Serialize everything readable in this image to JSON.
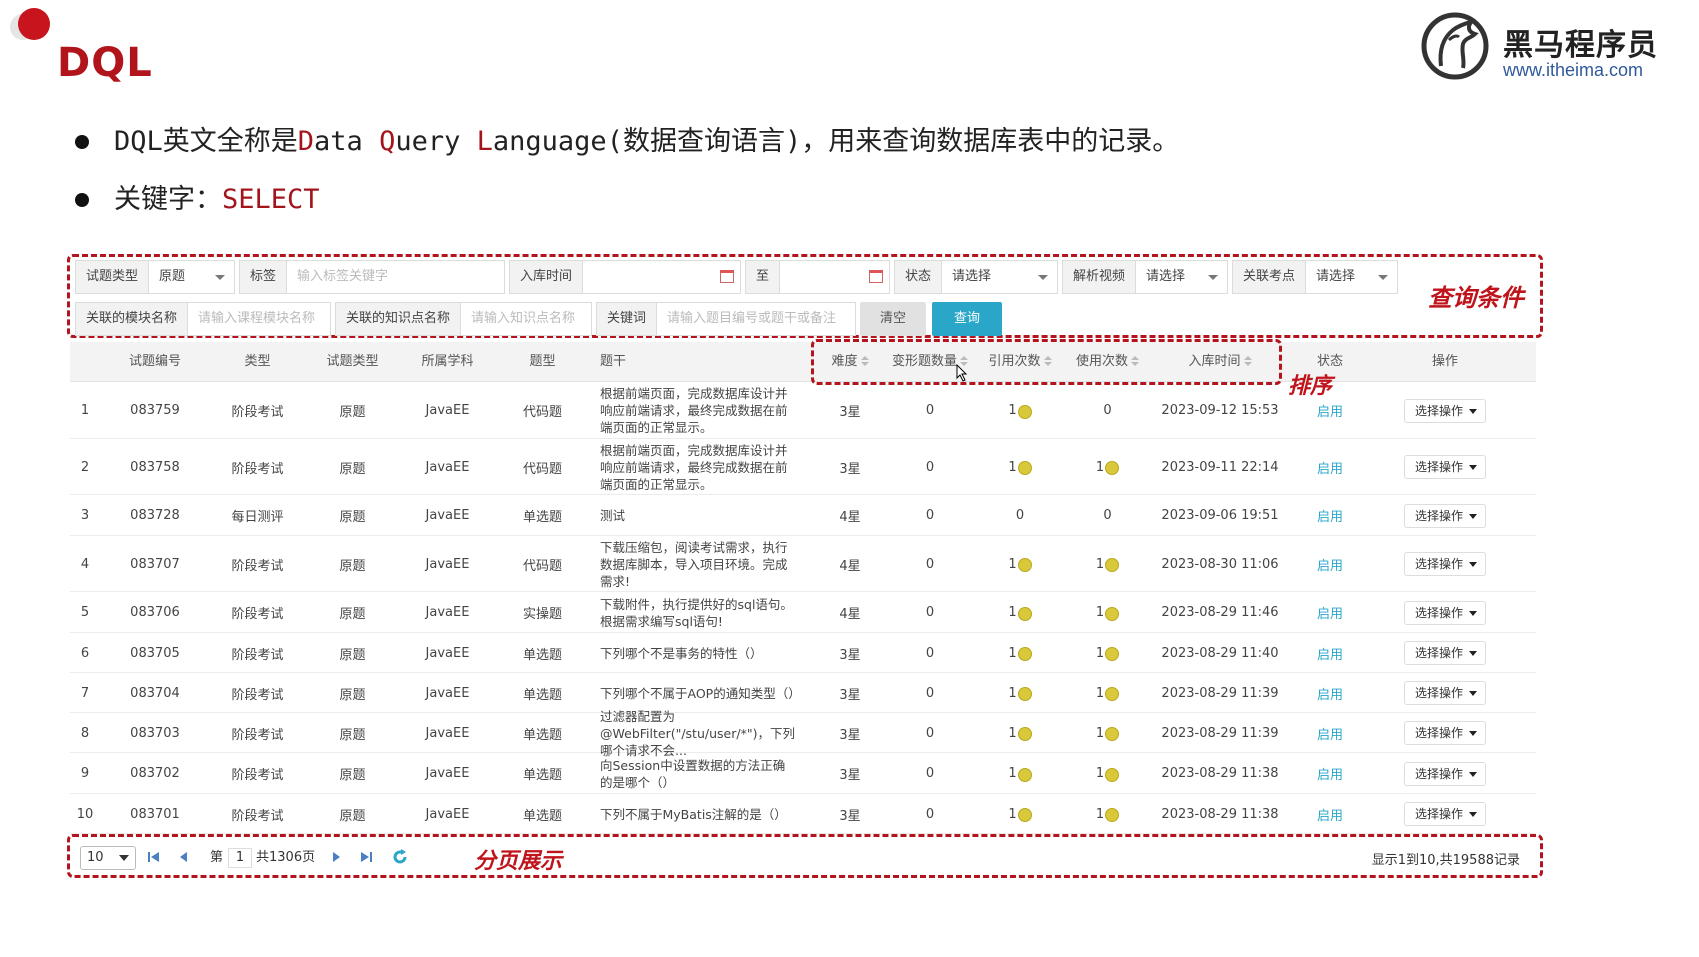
{
  "slide": {
    "title": "DQL",
    "brand_name": "黑马程序员",
    "brand_url": "www.itheima.com",
    "bullet1_prefix": "DQL英文全称是",
    "bullet1_d": "D",
    "bullet1_ata": "ata ",
    "bullet1_q": "Q",
    "bullet1_uery": "uery ",
    "bullet1_l": "L",
    "bullet1_anguage": "anguage",
    "bullet1_suffix": "(数据查询语言)，用来查询数据库表中的记录。",
    "bullet2_label": "关键字：",
    "bullet2_keyword": "SELECT"
  },
  "annotations": {
    "query_conditions": "查询条件",
    "sort": "排序",
    "pagination": "分页展示"
  },
  "filters": {
    "row1": [
      {
        "label": "试题类型",
        "value": "原题",
        "kind": "select"
      },
      {
        "label": "标签",
        "placeholder": "输入标签关键字",
        "kind": "input"
      },
      {
        "label": "入库时间",
        "kind": "date"
      },
      {
        "label": "至",
        "kind": "date"
      },
      {
        "label": "状态",
        "value": "请选择",
        "kind": "select"
      },
      {
        "label": "解析视频",
        "value": "请选择",
        "kind": "select"
      },
      {
        "label": "关联考点",
        "value": "请选择",
        "kind": "select"
      }
    ],
    "row2": [
      {
        "label": "关联的模块名称",
        "placeholder": "请输入课程模块名称",
        "kind": "input"
      },
      {
        "label": "关联的知识点名称",
        "placeholder": "请输入知识点名称",
        "kind": "input"
      },
      {
        "label": "关键词",
        "placeholder": "请输入题目编号或题干或备注",
        "kind": "input"
      }
    ],
    "clear_label": "清空",
    "query_label": "查询"
  },
  "table": {
    "headers": {
      "id": "试题编号",
      "type": "类型",
      "qtype": "试题类型",
      "subject": "所属学科",
      "form": "题型",
      "stem": "题干",
      "difficulty": "难度",
      "variants": "变形题数量",
      "refs": "引用次数",
      "uses": "使用次数",
      "time": "入库时间",
      "status": "状态",
      "ops": "操作"
    },
    "rows": [
      {
        "n": "1",
        "id": "083759",
        "type": "阶段考试",
        "qtype": "原题",
        "subject": "JavaEE",
        "form": "代码题",
        "stem": "根据前端页面，完成数据库设计并响应前端请求，最终完成数据在前端页面的正常显示。",
        "difficulty": "3星",
        "variants": "0",
        "refs": "1",
        "refs_coin": true,
        "uses": "0",
        "uses_coin": false,
        "time": "2023-09-12 15:53",
        "status": "启用",
        "op": "选择操作"
      },
      {
        "n": "2",
        "id": "083758",
        "type": "阶段考试",
        "qtype": "原题",
        "subject": "JavaEE",
        "form": "代码题",
        "stem": "根据前端页面，完成数据库设计并响应前端请求，最终完成数据在前端页面的正常显示。",
        "difficulty": "3星",
        "variants": "0",
        "refs": "1",
        "refs_coin": true,
        "uses": "1",
        "uses_coin": true,
        "time": "2023-09-11 22:14",
        "status": "启用",
        "op": "选择操作"
      },
      {
        "n": "3",
        "id": "083728",
        "type": "每日测评",
        "qtype": "原题",
        "subject": "JavaEE",
        "form": "单选题",
        "stem": "测试",
        "difficulty": "4星",
        "variants": "0",
        "refs": "0",
        "refs_coin": false,
        "uses": "0",
        "uses_coin": false,
        "time": "2023-09-06 19:51",
        "status": "启用",
        "op": "选择操作"
      },
      {
        "n": "4",
        "id": "083707",
        "type": "阶段考试",
        "qtype": "原题",
        "subject": "JavaEE",
        "form": "代码题",
        "stem": "下载压缩包，阅读考试需求，执行数据库脚本，导入项目环境。完成需求!",
        "difficulty": "4星",
        "variants": "0",
        "refs": "1",
        "refs_coin": true,
        "uses": "1",
        "uses_coin": true,
        "time": "2023-08-30 11:06",
        "status": "启用",
        "op": "选择操作"
      },
      {
        "n": "5",
        "id": "083706",
        "type": "阶段考试",
        "qtype": "原题",
        "subject": "JavaEE",
        "form": "实操题",
        "stem": "下载附件，执行提供好的sql语句。根据需求编写sql语句!",
        "difficulty": "4星",
        "variants": "0",
        "refs": "1",
        "refs_coin": true,
        "uses": "1",
        "uses_coin": true,
        "time": "2023-08-29 11:46",
        "status": "启用",
        "op": "选择操作"
      },
      {
        "n": "6",
        "id": "083705",
        "type": "阶段考试",
        "qtype": "原题",
        "subject": "JavaEE",
        "form": "单选题",
        "stem": "下列哪个不是事务的特性（）",
        "difficulty": "3星",
        "variants": "0",
        "refs": "1",
        "refs_coin": true,
        "uses": "1",
        "uses_coin": true,
        "time": "2023-08-29 11:40",
        "status": "启用",
        "op": "选择操作"
      },
      {
        "n": "7",
        "id": "083704",
        "type": "阶段考试",
        "qtype": "原题",
        "subject": "JavaEE",
        "form": "单选题",
        "stem": "下列哪个不属于AOP的通知类型（）",
        "difficulty": "3星",
        "variants": "0",
        "refs": "1",
        "refs_coin": true,
        "uses": "1",
        "uses_coin": true,
        "time": "2023-08-29 11:39",
        "status": "启用",
        "op": "选择操作"
      },
      {
        "n": "8",
        "id": "083703",
        "type": "阶段考试",
        "qtype": "原题",
        "subject": "JavaEE",
        "form": "单选题",
        "stem": "过滤器配置为@WebFilter(\"/stu/user/*\")，下列哪个请求不会...",
        "difficulty": "3星",
        "variants": "0",
        "refs": "1",
        "refs_coin": true,
        "uses": "1",
        "uses_coin": true,
        "time": "2023-08-29 11:39",
        "status": "启用",
        "op": "选择操作"
      },
      {
        "n": "9",
        "id": "083702",
        "type": "阶段考试",
        "qtype": "原题",
        "subject": "JavaEE",
        "form": "单选题",
        "stem": "向Session中设置数据的方法正确的是哪个（）",
        "difficulty": "3星",
        "variants": "0",
        "refs": "1",
        "refs_coin": true,
        "uses": "1",
        "uses_coin": true,
        "time": "2023-08-29 11:38",
        "status": "启用",
        "op": "选择操作"
      },
      {
        "n": "10",
        "id": "083701",
        "type": "阶段考试",
        "qtype": "原题",
        "subject": "JavaEE",
        "form": "单选题",
        "stem": "下列不属于MyBatis注解的是（）",
        "difficulty": "3星",
        "variants": "0",
        "refs": "1",
        "refs_coin": true,
        "uses": "1",
        "uses_coin": true,
        "time": "2023-08-29 11:38",
        "status": "启用",
        "op": "选择操作"
      }
    ]
  },
  "pager": {
    "page_size": "10",
    "page_prefix": "第",
    "current_page": "1",
    "total_pages": "共1306页",
    "summary": "显示1到10,共19588记录"
  },
  "colors": {
    "accent_red": "#b3141d",
    "query_button": "#2aa6c9",
    "status_link": "#2aa6c9"
  }
}
